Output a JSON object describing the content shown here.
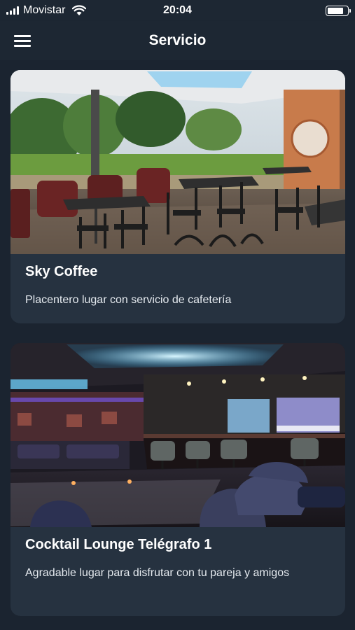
{
  "status_bar": {
    "carrier": "Movistar",
    "time": "20:04",
    "signal_icon": "signal-bars-icon",
    "wifi_icon": "wifi-icon",
    "battery_icon": "battery-icon",
    "battery_level": 0.8
  },
  "header": {
    "title": "Servicio",
    "menu_icon": "hamburger-menu-icon"
  },
  "services": [
    {
      "title": "Sky Coffee",
      "description": "Placentero lugar con servicio de cafetería",
      "image": "outdoor-terrace-cafe-photo"
    },
    {
      "title": "Cocktail Lounge Telégrafo 1",
      "description": "Agradable lugar para disfrutar con tu pareja y amigos",
      "image": "cocktail-lounge-bar-photo"
    }
  ],
  "colors": {
    "background": "#1b2430",
    "header": "#1d2733",
    "card": "#263240",
    "text": "#ffffff"
  }
}
